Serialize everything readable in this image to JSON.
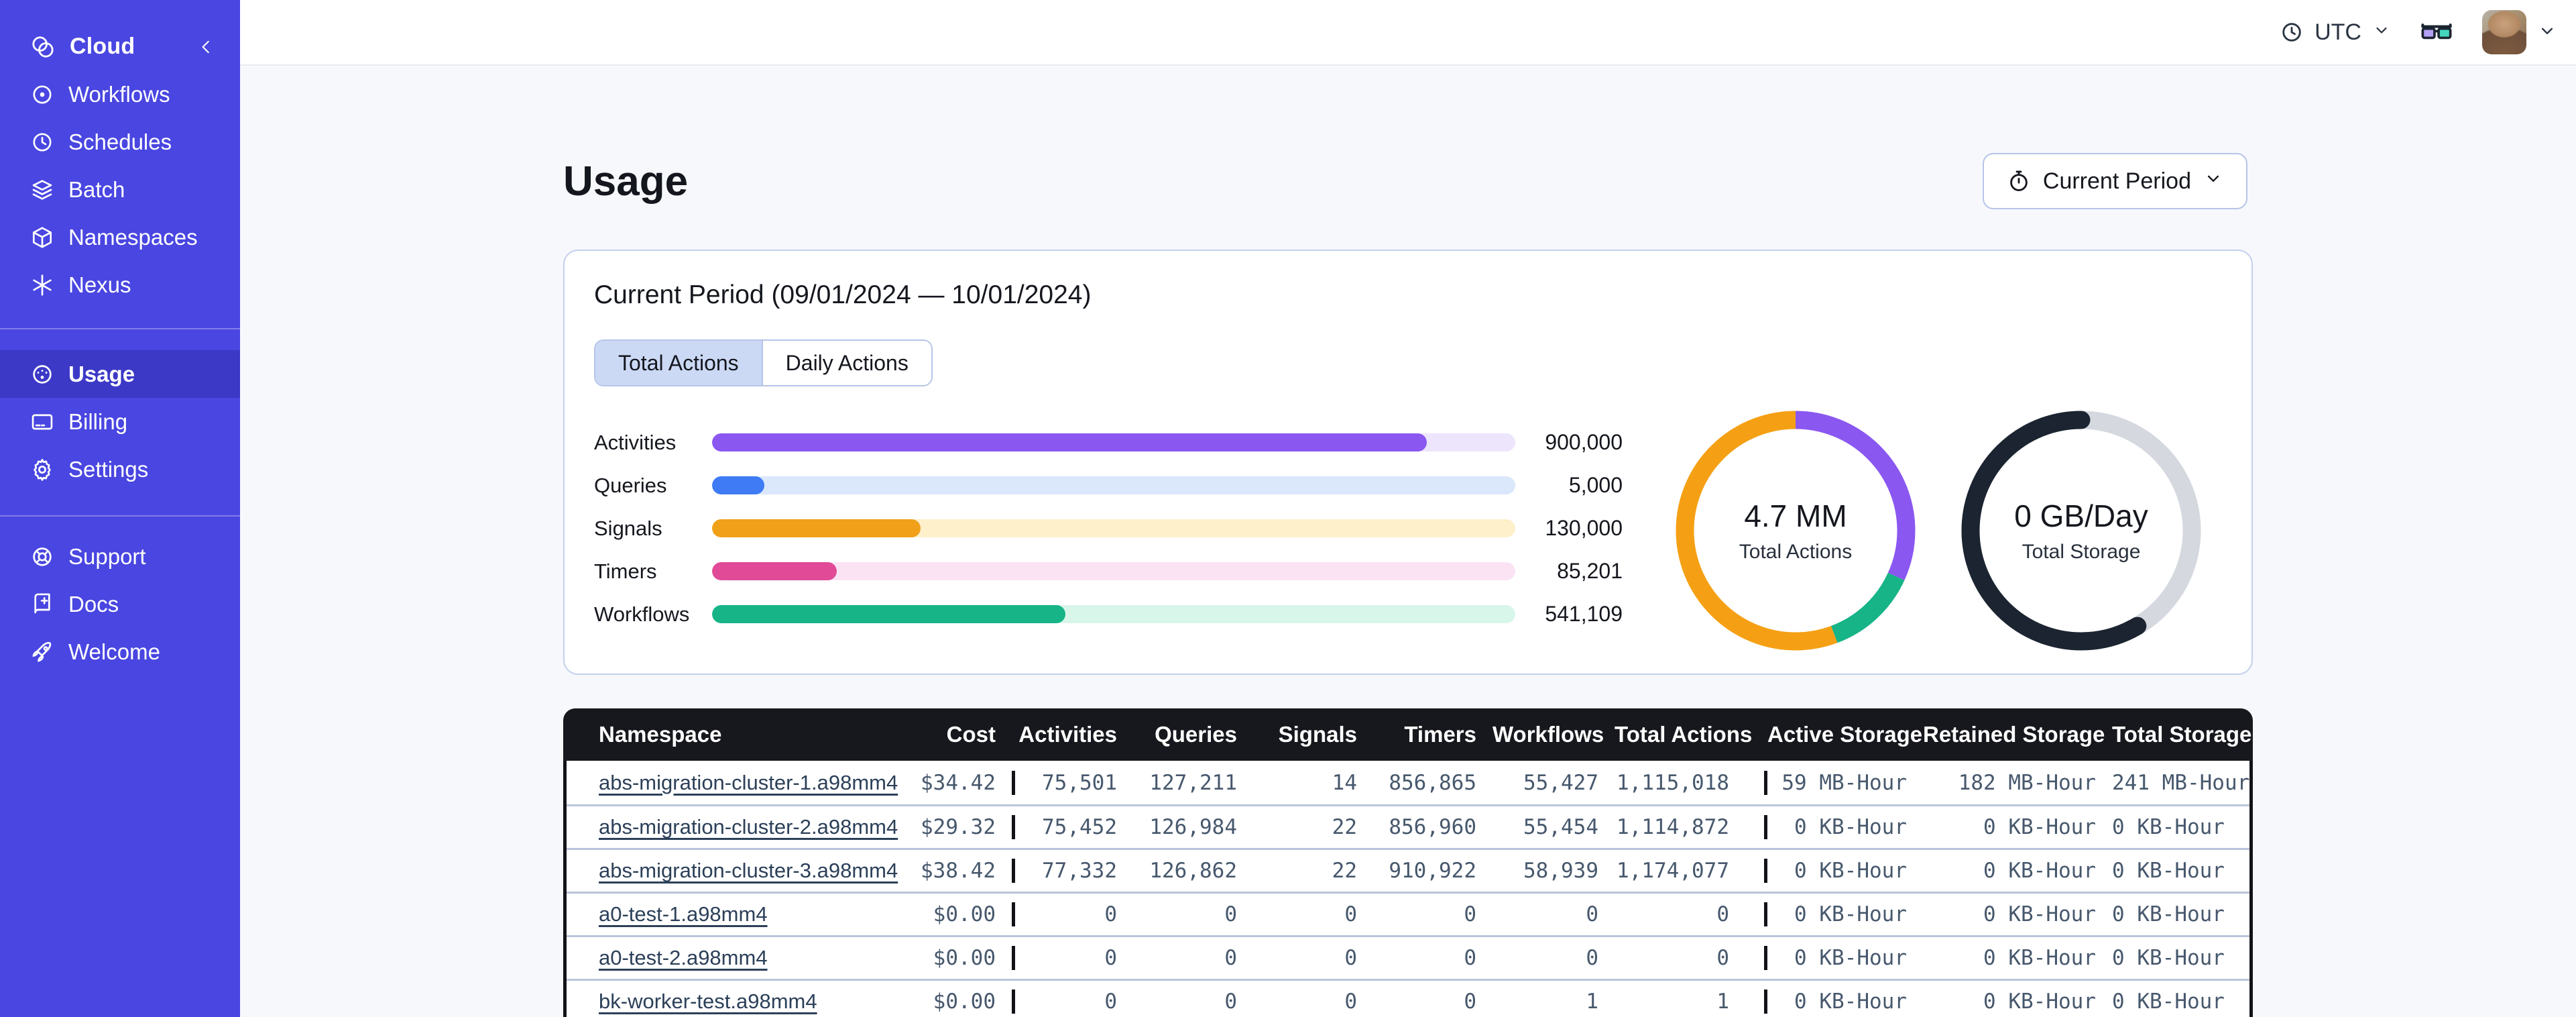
{
  "topbar": {
    "timezone": "UTC"
  },
  "sidebar": {
    "brand": "Cloud",
    "sections": [
      {
        "items": [
          {
            "id": "workflows",
            "label": "Workflows",
            "icon": "workflows"
          },
          {
            "id": "schedules",
            "label": "Schedules",
            "icon": "schedules"
          },
          {
            "id": "batch",
            "label": "Batch",
            "icon": "batch"
          },
          {
            "id": "namespaces",
            "label": "Namespaces",
            "icon": "namespaces"
          },
          {
            "id": "nexus",
            "label": "Nexus",
            "icon": "nexus"
          }
        ]
      },
      {
        "items": [
          {
            "id": "usage",
            "label": "Usage",
            "icon": "usage",
            "active": true
          },
          {
            "id": "billing",
            "label": "Billing",
            "icon": "billing"
          },
          {
            "id": "settings",
            "label": "Settings",
            "icon": "settings"
          }
        ]
      },
      {
        "items": [
          {
            "id": "support",
            "label": "Support",
            "icon": "support"
          },
          {
            "id": "docs",
            "label": "Docs",
            "icon": "docs"
          },
          {
            "id": "welcome",
            "label": "Welcome",
            "icon": "welcome"
          }
        ]
      }
    ]
  },
  "page": {
    "title": "Usage",
    "period_selector": {
      "label": "Current Period",
      "icon": "stopwatch"
    }
  },
  "usage_card": {
    "title": "Current Period (09/01/2024 — 10/01/2024)",
    "tabs": [
      {
        "label": "Total Actions",
        "active": true
      },
      {
        "label": "Daily Actions",
        "active": false
      }
    ]
  },
  "chart_data": [
    {
      "type": "bar",
      "title": "Actions by type (current period)",
      "categories": [
        "Activities",
        "Queries",
        "Signals",
        "Timers",
        "Workflows"
      ],
      "values": [
        900000,
        5000,
        130000,
        85201,
        541109
      ],
      "value_labels": [
        "900,000",
        "5,000",
        "130,000",
        "85,201",
        "541,109"
      ],
      "fill_fractions": [
        0.89,
        0.065,
        0.26,
        0.155,
        0.44
      ],
      "bar_colors": [
        "#8a57f0",
        "#3e7bf5",
        "#f0a019",
        "#e04a96",
        "#16b487"
      ],
      "track_colors": [
        "#ece5fc",
        "#dbe7fb",
        "#fdf0cb",
        "#fbe3f4",
        "#d8f6e9"
      ],
      "xlabel": "",
      "ylabel": "",
      "legend": false,
      "grid": false
    },
    {
      "type": "pie",
      "title": "Total Actions donut",
      "center_value": "4.7 MM",
      "center_label": "Total Actions",
      "segments": [
        {
          "name": "activities",
          "color": "#8a57f0",
          "fraction": 0.318
        },
        {
          "name": "workflows",
          "color": "#16b487",
          "fraction": 0.125
        },
        {
          "name": "signals",
          "color": "#f5a014",
          "fraction": 0.557
        }
      ]
    },
    {
      "type": "pie",
      "title": "Total Storage donut",
      "center_value": "0 GB/Day",
      "center_label": "Total Storage",
      "segments": [
        {
          "name": "track",
          "color": "#d5d8df",
          "fraction": 1.0,
          "track": true
        },
        {
          "name": "used",
          "color": "#1b2430",
          "fraction": 0.585,
          "start_fraction": 0.415,
          "rounded": true
        }
      ]
    }
  ],
  "table": {
    "columns": [
      "Namespace",
      "Cost",
      "Activities",
      "Queries",
      "Signals",
      "Timers",
      "Workflows",
      "Total Actions",
      "Active Storage",
      "Retained Storage",
      "Total Storage"
    ],
    "rows": [
      [
        "abs-migration-cluster-1.a98mm4",
        "$34.42",
        "75,501",
        "127,211",
        "14",
        "856,865",
        "55,427",
        "1,115,018",
        "59 MB-Hour",
        "182 MB-Hour",
        "241 MB-Hour"
      ],
      [
        "abs-migration-cluster-2.a98mm4",
        "$29.32",
        "75,452",
        "126,984",
        "22",
        "856,960",
        "55,454",
        "1,114,872",
        "0 KB-Hour",
        "0 KB-Hour",
        "0 KB-Hour"
      ],
      [
        "abs-migration-cluster-3.a98mm4",
        "$38.42",
        "77,332",
        "126,862",
        "22",
        "910,922",
        "58,939",
        "1,174,077",
        "0 KB-Hour",
        "0 KB-Hour",
        "0 KB-Hour"
      ],
      [
        "a0-test-1.a98mm4",
        "$0.00",
        "0",
        "0",
        "0",
        "0",
        "0",
        "0",
        "0 KB-Hour",
        "0 KB-Hour",
        "0 KB-Hour"
      ],
      [
        "a0-test-2.a98mm4",
        "$0.00",
        "0",
        "0",
        "0",
        "0",
        "0",
        "0",
        "0 KB-Hour",
        "0 KB-Hour",
        "0 KB-Hour"
      ],
      [
        "bk-worker-test.a98mm4",
        "$0.00",
        "0",
        "0",
        "0",
        "0",
        "1",
        "1",
        "0 KB-Hour",
        "0 KB-Hour",
        "0 KB-Hour"
      ]
    ]
  }
}
